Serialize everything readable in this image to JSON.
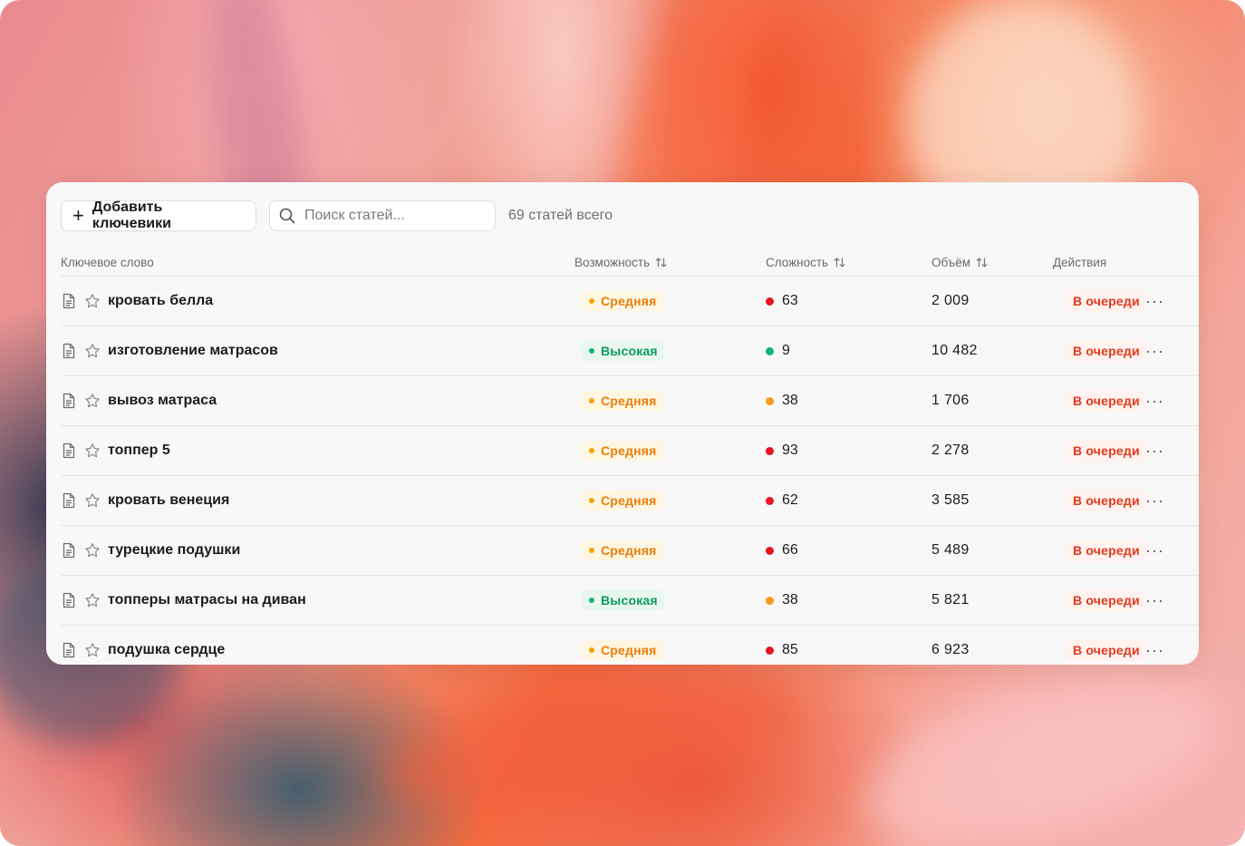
{
  "toolbar": {
    "add_label": "Добавить ключевики",
    "search_placeholder": "Поиск статей...",
    "total_label": "69 статей всего"
  },
  "columns": {
    "keyword": "Ключевое слово",
    "opportunity": "Возможность",
    "difficulty": "Сложность",
    "volume": "Объём",
    "actions": "Действия"
  },
  "colors": {
    "medium_text": "#e87f0c",
    "medium_bg": "#fff6e2",
    "medium_dot": "#f5a30a",
    "high_text": "#0e9a62",
    "high_bg": "#e8f7ef",
    "high_dot": "#14b372",
    "diff_red": "#e8141f",
    "diff_orange": "#f59a1a",
    "diff_green": "#14b372",
    "status_text": "#e3391c"
  },
  "rows": [
    {
      "keyword": "кровать белла",
      "opportunity": "Средняя",
      "opp_level": "medium",
      "difficulty": "63",
      "diff_color": "red",
      "volume": "2 009",
      "status": "В очереди",
      "more": "···"
    },
    {
      "keyword": "изготовление матрасов",
      "opportunity": "Высокая",
      "opp_level": "high",
      "difficulty": "9",
      "diff_color": "green",
      "volume": "10 482",
      "status": "В очереди",
      "more": "···"
    },
    {
      "keyword": "вывоз матраса",
      "opportunity": "Средняя",
      "opp_level": "medium",
      "difficulty": "38",
      "diff_color": "orange",
      "volume": "1 706",
      "status": "В очереди",
      "more": "···"
    },
    {
      "keyword": "топпер 5",
      "opportunity": "Средняя",
      "opp_level": "medium",
      "difficulty": "93",
      "diff_color": "red",
      "volume": "2 278",
      "status": "В очереди",
      "more": "···"
    },
    {
      "keyword": "кровать венеция",
      "opportunity": "Средняя",
      "opp_level": "medium",
      "difficulty": "62",
      "diff_color": "red",
      "volume": "3 585",
      "status": "В очереди",
      "more": "···"
    },
    {
      "keyword": "турецкие подушки",
      "opportunity": "Средняя",
      "opp_level": "medium",
      "difficulty": "66",
      "diff_color": "red",
      "volume": "5 489",
      "status": "В очереди",
      "more": "···"
    },
    {
      "keyword": "топперы матрасы на диван",
      "opportunity": "Высокая",
      "opp_level": "high",
      "difficulty": "38",
      "diff_color": "orange",
      "volume": "5 821",
      "status": "В очереди",
      "more": "···"
    },
    {
      "keyword": "подушка сердце",
      "opportunity": "Средняя",
      "opp_level": "medium",
      "difficulty": "85",
      "diff_color": "red",
      "volume": "6 923",
      "status": "В очереди",
      "more": "···"
    }
  ]
}
